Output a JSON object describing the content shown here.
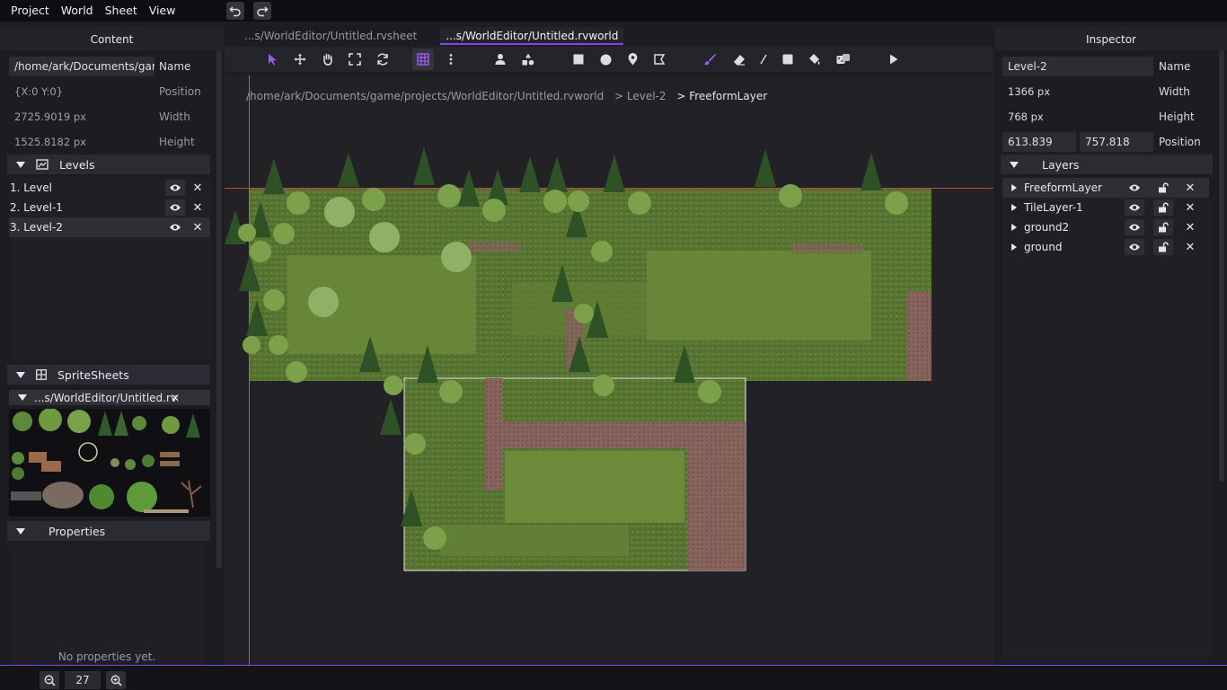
{
  "menu": [
    "Project",
    "World",
    "Sheet",
    "View"
  ],
  "content_panel": {
    "title": "Content",
    "path_value": "/home/ark/Documents/game",
    "name_label": "Name",
    "position_value": "{X:0 Y:0}",
    "position_label": "Position",
    "width_value": "2725.9019 px",
    "width_label": "Width",
    "height_value": "1525.8182 px",
    "height_label": "Height"
  },
  "levels": {
    "title": "Levels",
    "items": [
      "1. Level",
      "2. Level-1",
      "3. Level-2"
    ]
  },
  "spritesheets": {
    "title": "SpriteSheets",
    "sheet_name": "...s/WorldEditor/Untitled.rvsheet"
  },
  "properties": {
    "title": "Properties",
    "empty_text": "No properties yet."
  },
  "tabs": [
    "...s/WorldEditor/Untitled.rvsheet",
    "...s/WorldEditor/Untitled.rvworld"
  ],
  "breadcrumb": [
    "/home/ark/Documents/game/projects/WorldEditor/Untitled.rvworld",
    "> Level-2",
    "> FreeformLayer"
  ],
  "inspector": {
    "title": "Inspector",
    "name_value": "Level-2",
    "name_label": "Name",
    "width_value": "1366 px",
    "width_label": "Width",
    "height_value": "768 px",
    "height_label": "Height",
    "pos_x": "613.839",
    "pos_y": "757.818",
    "position_label": "Position"
  },
  "layers": {
    "title": "Layers",
    "items": [
      "FreeformLayer",
      "TileLayer-1",
      "ground2",
      "ground"
    ]
  },
  "zoom": {
    "value": "27"
  },
  "colors": {
    "accent": "#8a3ff0",
    "grass": "#5e7a34",
    "path": "#8a6560"
  }
}
